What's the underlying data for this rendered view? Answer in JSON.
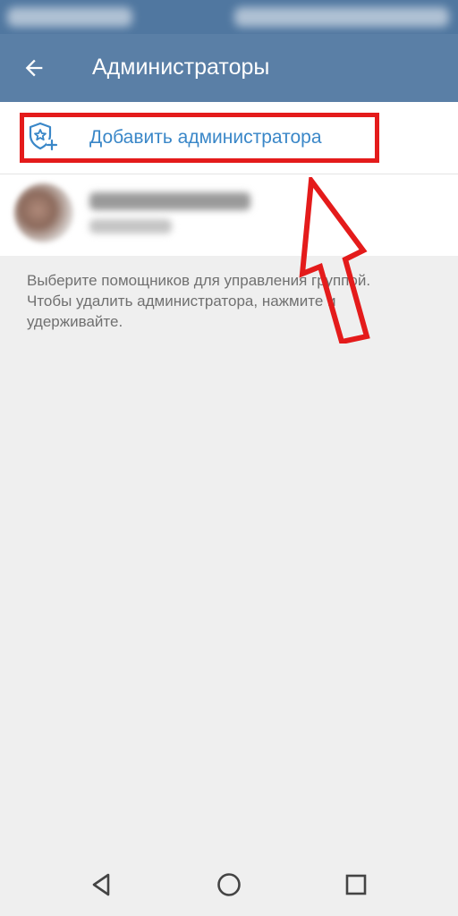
{
  "app_bar": {
    "title": "Администраторы",
    "back_icon": "arrow-back-icon",
    "background": "#5a7fa6"
  },
  "actions": {
    "add_admin_label": "Добавить администратора",
    "add_admin_icon": "shield-star-plus-icon",
    "accent": "#3a87c8"
  },
  "admins": [
    {
      "avatar": "avatar-photo",
      "name": "",
      "role": "",
      "blurred": true
    }
  ],
  "hint": "Выберите помощников для управления группой. Чтобы удалить администратора, нажмите и удерживайте.",
  "annotation": {
    "highlight_color": "#e41b1b"
  },
  "nav": {
    "back_icon": "nav-back-triangle-icon",
    "home_icon": "nav-home-circle-icon",
    "recents_icon": "nav-recents-square-icon"
  }
}
